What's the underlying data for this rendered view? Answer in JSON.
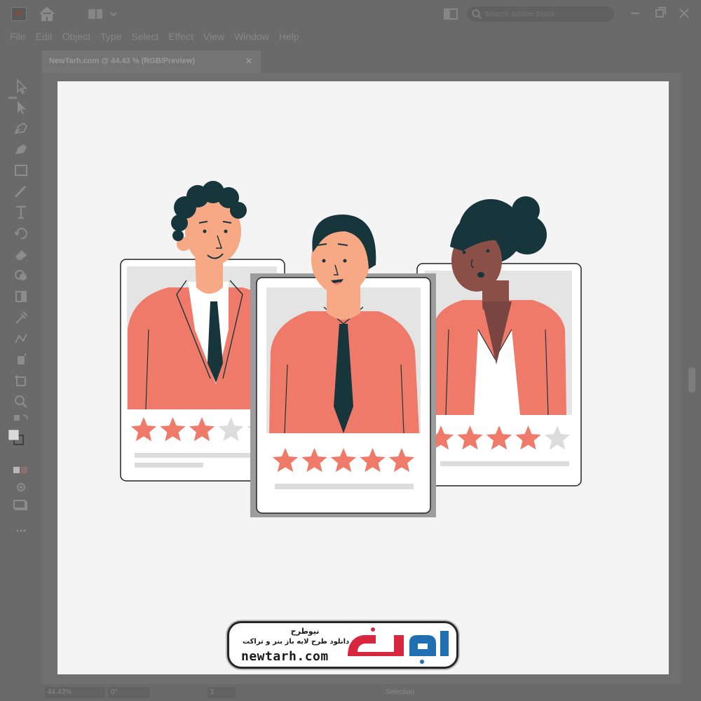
{
  "titlebar": {
    "app_icon": "illustrator-app-icon",
    "app_icon_text": "Ai",
    "search_placeholder": "Search Adobe Stock"
  },
  "menubar": {
    "items": [
      "File",
      "Edit",
      "Object",
      "Type",
      "Select",
      "Effect",
      "View",
      "Window",
      "Help"
    ]
  },
  "document_tab": {
    "title": "NewTarh.com @ 44.43 % (RGB/Preview)",
    "close_label": "✕"
  },
  "statusbar": {
    "zoom": "44.43%",
    "rotation": "0°",
    "artboard": "1",
    "mode": "Selection"
  },
  "cards": [
    {
      "rating": 3,
      "max_rating": 5
    },
    {
      "rating": 5,
      "max_rating": 5
    },
    {
      "rating": 4,
      "max_rating": 5
    }
  ],
  "colors": {
    "accent": "#f07a69",
    "star_empty": "#dcdcdc",
    "hair": "#17363b",
    "skin_light": "#f7a985",
    "skin_dark": "#8a5048",
    "artboard": "#f4f4f4"
  },
  "badge": {
    "title": "نیوطرح",
    "subtitle": "دانلود طرح لایه باز بنر و تراکت",
    "url": "newtarh.com",
    "logo_text": "نیوطرح"
  }
}
